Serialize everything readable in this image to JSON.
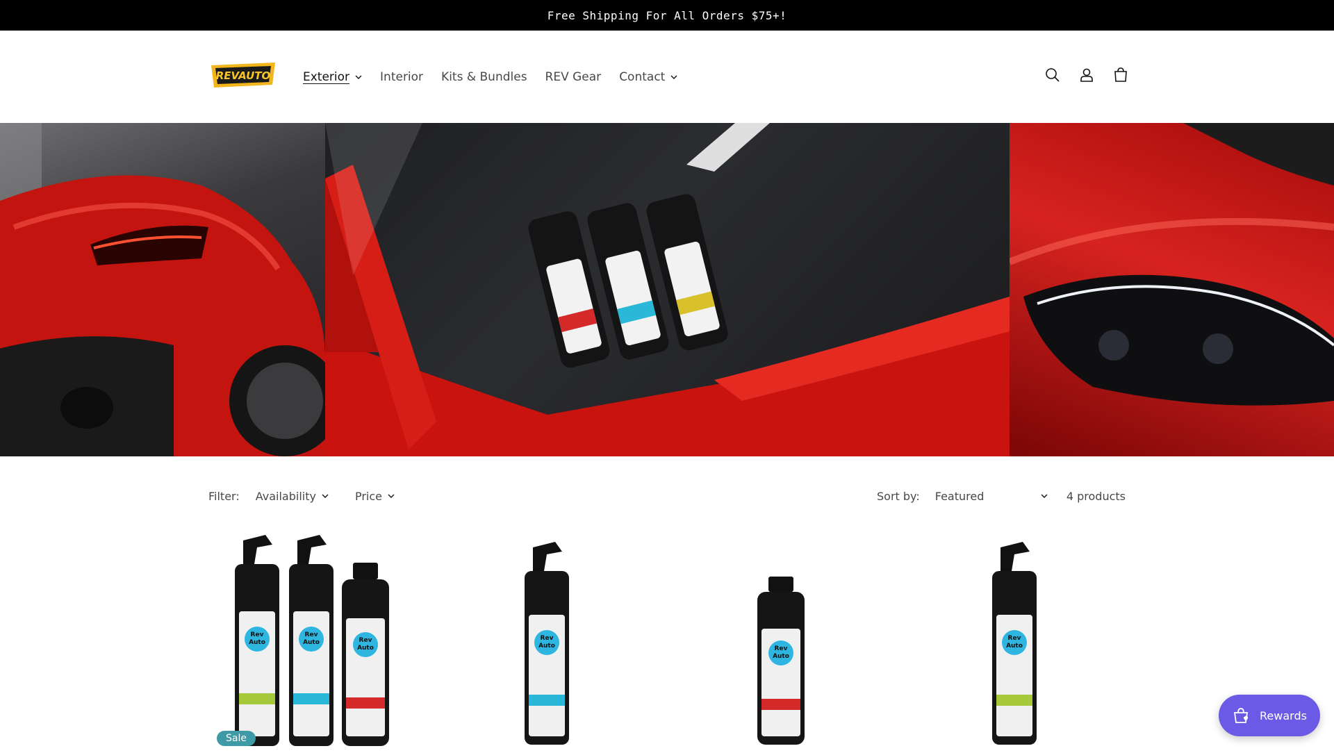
{
  "announcement": {
    "text": "Free Shipping For All Orders $75+!"
  },
  "logo": {
    "text": "REVAUTO"
  },
  "nav": {
    "items": [
      {
        "label": "Exterior",
        "has_dropdown": true,
        "active": true
      },
      {
        "label": "Interior",
        "has_dropdown": false
      },
      {
        "label": "Kits & Bundles",
        "has_dropdown": false
      },
      {
        "label": "REV Gear",
        "has_dropdown": false
      },
      {
        "label": "Contact",
        "has_dropdown": true
      }
    ]
  },
  "header_icons": [
    "search-icon",
    "account-icon",
    "cart-icon"
  ],
  "product_bottle_label": {
    "brand_line1": "Rev",
    "brand_line2": "Auto"
  },
  "filters": {
    "label": "Filter:",
    "availability": "Availability",
    "price": "Price",
    "sort_label": "Sort by:",
    "sort_value": "Featured",
    "count": "4 products"
  },
  "products": [
    {
      "badge": "Sale",
      "accents": [
        "#a6c93a",
        "#2ab8d8",
        "#d42a2a"
      ]
    },
    {
      "badge": "",
      "accents": [
        "#2ab8d8"
      ]
    },
    {
      "badge": "",
      "accents": [
        "#d42a2a"
      ]
    },
    {
      "badge": "",
      "accents": [
        "#a6c93a"
      ]
    }
  ],
  "rewards": {
    "label": "Rewards"
  },
  "colors": {
    "announcement_bg": "#000000",
    "sale_badge": "#3d9aa6",
    "rewards_bg": "#6b5ae6",
    "car_red": "#d7231f"
  }
}
